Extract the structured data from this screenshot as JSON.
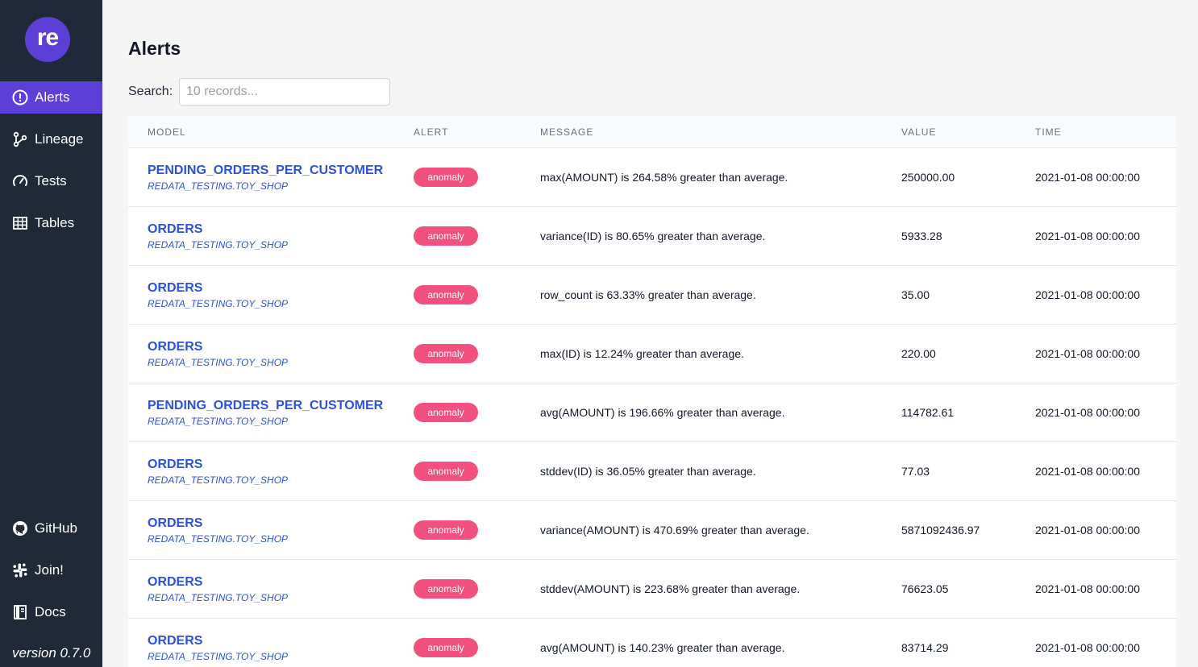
{
  "app": {
    "logo_text": "re",
    "version": "version 0.7.0"
  },
  "sidebar": {
    "items": [
      {
        "label": "Alerts",
        "icon": "alert-circle-icon"
      },
      {
        "label": "Lineage",
        "icon": "lineage-icon"
      },
      {
        "label": "Tests",
        "icon": "gauge-icon"
      },
      {
        "label": "Tables",
        "icon": "table-icon"
      }
    ],
    "bottom_items": [
      {
        "label": "GitHub",
        "icon": "github-icon"
      },
      {
        "label": "Join!",
        "icon": "slack-icon"
      },
      {
        "label": "Docs",
        "icon": "book-icon"
      }
    ]
  },
  "page": {
    "title": "Alerts"
  },
  "search": {
    "label": "Search:",
    "placeholder": "10 records..."
  },
  "table": {
    "columns": [
      "MODEL",
      "ALERT",
      "MESSAGE",
      "VALUE",
      "TIME"
    ],
    "rows": [
      {
        "model": "PENDING_ORDERS_PER_CUSTOMER",
        "schema": "REDATA_TESTING.TOY_SHOP",
        "alert": "anomaly",
        "message": "max(AMOUNT) is 264.58% greater than average.",
        "value": "250000.00",
        "time": "2021-01-08 00:00:00"
      },
      {
        "model": "ORDERS",
        "schema": "REDATA_TESTING.TOY_SHOP",
        "alert": "anomaly",
        "message": "variance(ID) is 80.65% greater than average.",
        "value": "5933.28",
        "time": "2021-01-08 00:00:00"
      },
      {
        "model": "ORDERS",
        "schema": "REDATA_TESTING.TOY_SHOP",
        "alert": "anomaly",
        "message": "row_count is 63.33% greater than average.",
        "value": "35.00",
        "time": "2021-01-08 00:00:00"
      },
      {
        "model": "ORDERS",
        "schema": "REDATA_TESTING.TOY_SHOP",
        "alert": "anomaly",
        "message": "max(ID) is 12.24% greater than average.",
        "value": "220.00",
        "time": "2021-01-08 00:00:00"
      },
      {
        "model": "PENDING_ORDERS_PER_CUSTOMER",
        "schema": "REDATA_TESTING.TOY_SHOP",
        "alert": "anomaly",
        "message": "avg(AMOUNT) is 196.66% greater than average.",
        "value": "114782.61",
        "time": "2021-01-08 00:00:00"
      },
      {
        "model": "ORDERS",
        "schema": "REDATA_TESTING.TOY_SHOP",
        "alert": "anomaly",
        "message": "stddev(ID) is 36.05% greater than average.",
        "value": "77.03",
        "time": "2021-01-08 00:00:00"
      },
      {
        "model": "ORDERS",
        "schema": "REDATA_TESTING.TOY_SHOP",
        "alert": "anomaly",
        "message": "variance(AMOUNT) is 470.69% greater than average.",
        "value": "5871092436.97",
        "time": "2021-01-08 00:00:00"
      },
      {
        "model": "ORDERS",
        "schema": "REDATA_TESTING.TOY_SHOP",
        "alert": "anomaly",
        "message": "stddev(AMOUNT) is 223.68% greater than average.",
        "value": "76623.05",
        "time": "2021-01-08 00:00:00"
      },
      {
        "model": "ORDERS",
        "schema": "REDATA_TESTING.TOY_SHOP",
        "alert": "anomaly",
        "message": "avg(AMOUNT) is 140.23% greater than average.",
        "value": "83714.29",
        "time": "2021-01-08 00:00:00"
      }
    ]
  },
  "colors": {
    "sidebar_bg": "#1f2937",
    "accent": "#5b3fd6",
    "link": "#2b52d9",
    "badge": "#f2517f"
  }
}
